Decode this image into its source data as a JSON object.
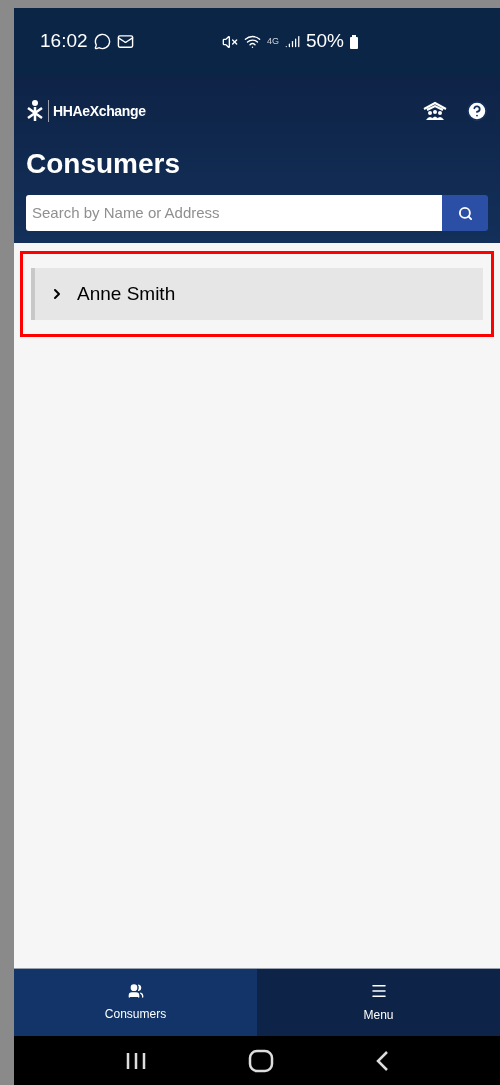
{
  "status_bar": {
    "time": "16:02",
    "network": "4G",
    "battery": "50%"
  },
  "header": {
    "logo_text": "HHAeXchange",
    "title": "Consumers"
  },
  "search": {
    "placeholder": "Search by Name or Address"
  },
  "consumers": [
    {
      "name": "Anne Smith",
      "expanded": false,
      "highlighted": true
    }
  ],
  "tabs": [
    {
      "label": "Consumers",
      "kind": "people",
      "selected": true
    },
    {
      "label": "Menu",
      "kind": "menu",
      "selected": false
    }
  ]
}
